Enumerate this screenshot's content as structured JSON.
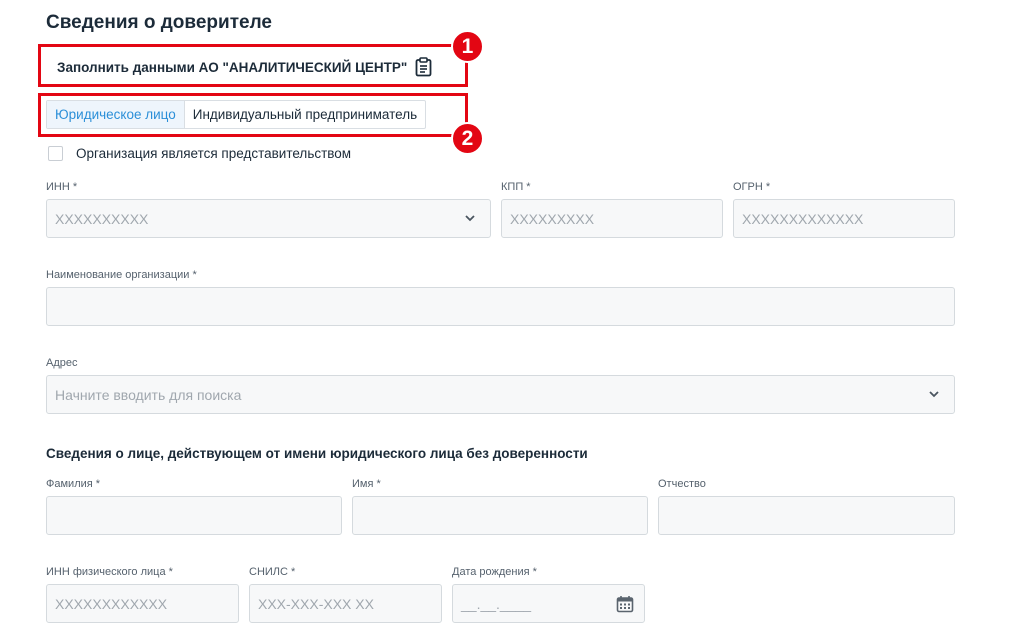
{
  "section_title": "Сведения о доверителе",
  "fill_button": {
    "label": "Заполнить данными АО \"АНАЛИТИЧЕСКИЙ ЦЕНТР\""
  },
  "tabs": [
    {
      "label": "Юридическое лицо",
      "active": true
    },
    {
      "label": "Индивидуальный предприниматель",
      "active": false
    }
  ],
  "checkbox": {
    "label": "Организация является представительством",
    "checked": false
  },
  "fields": {
    "inn": {
      "label": "ИНН *",
      "placeholder": "XXXXXXXXXX"
    },
    "kpp": {
      "label": "КПП *",
      "placeholder": "XXXXXXXXX"
    },
    "ogrn": {
      "label": "ОГРН *",
      "placeholder": "XXXXXXXXXXXXX"
    },
    "org_name": {
      "label": "Наименование организации *",
      "placeholder": ""
    },
    "address": {
      "label": "Адрес",
      "placeholder": "Начните вводить для поиска"
    },
    "last_name": {
      "label": "Фамилия *",
      "placeholder": ""
    },
    "first_name": {
      "label": "Имя *",
      "placeholder": ""
    },
    "middle_name": {
      "label": "Отчество",
      "placeholder": ""
    },
    "person_inn": {
      "label": "ИНН физического лица *",
      "placeholder": "XXXXXXXXXXXX"
    },
    "snils": {
      "label": "СНИЛС *",
      "placeholder": "XXX-XXX-XXX XX"
    },
    "birth_date": {
      "label": "Дата рождения *",
      "placeholder": "__.__.____"
    }
  },
  "subsection_title": "Сведения о лице, действующем от имени юридического лица без доверенности",
  "annotations": [
    "1",
    "2"
  ],
  "colors": {
    "accent": "#2b8fd8",
    "annotation": "#e30613",
    "field_bg": "#f7f8f9"
  }
}
